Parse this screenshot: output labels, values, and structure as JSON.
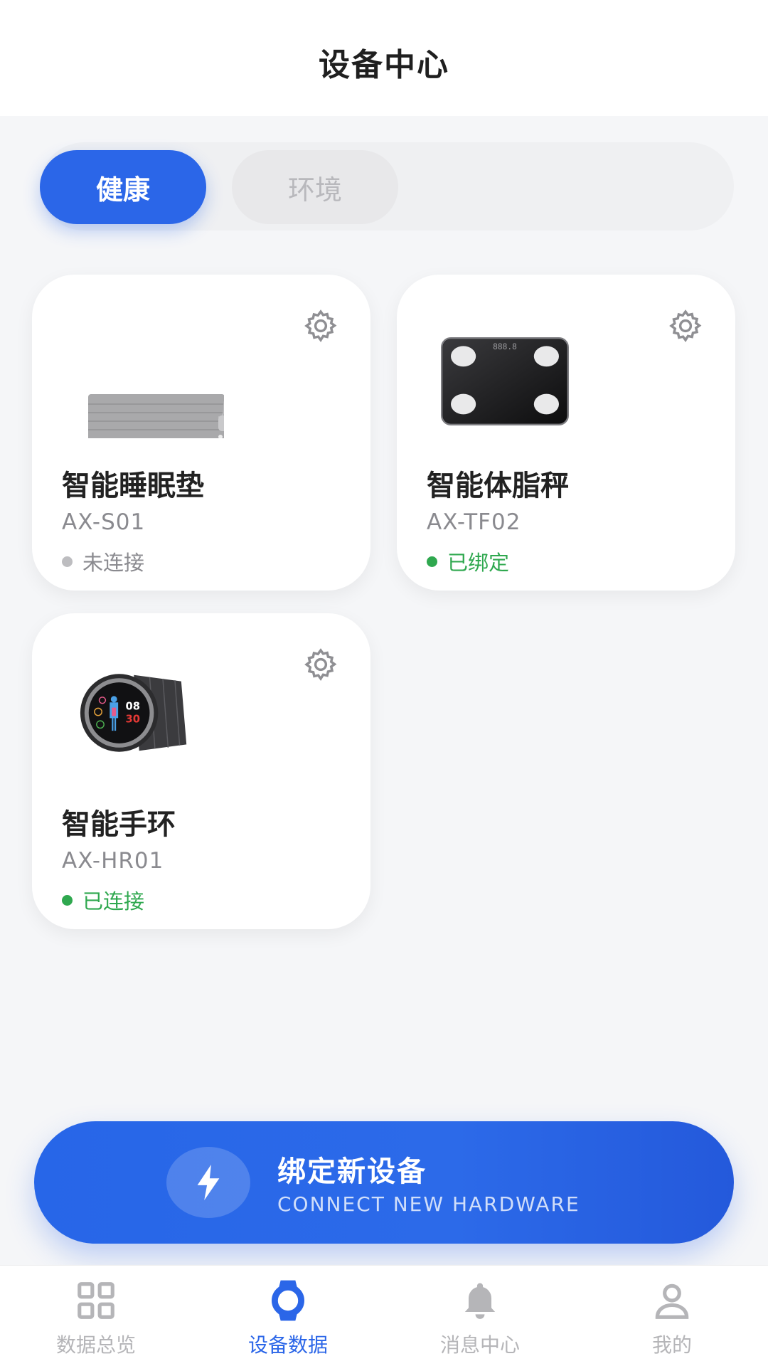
{
  "header": {
    "title": "设备中心"
  },
  "tabs": [
    {
      "label": "健康",
      "active": true
    },
    {
      "label": "环境",
      "active": false
    }
  ],
  "devices": [
    {
      "name": "智能睡眠垫",
      "model": "AX-S01",
      "status": "未连接",
      "state": "disconnected",
      "icon": "sleep-pad-image"
    },
    {
      "name": "智能体脂秤",
      "model": "AX-TF02",
      "status": "已绑定",
      "state": "bound",
      "icon": "body-fat-scale-image",
      "scale_display": "888.8"
    },
    {
      "name": "智能手环",
      "model": "AX-HR01",
      "status": "已连接",
      "state": "connected",
      "icon": "smart-watch-image",
      "watch_display": [
        "08",
        "30"
      ]
    }
  ],
  "bind": {
    "title": "绑定新设备",
    "subtitle": "CONNECT NEW HARDWARE"
  },
  "nav": [
    {
      "label": "数据总览",
      "icon": "grid-icon",
      "active": false
    },
    {
      "label": "设备数据",
      "icon": "watch-icon",
      "active": true
    },
    {
      "label": "消息中心",
      "icon": "bell-icon",
      "active": false
    },
    {
      "label": "我的",
      "icon": "user-icon",
      "active": false
    }
  ],
  "colors": {
    "primary": "#2b66e8",
    "status_connected": "#2fa84f",
    "status_disconnected": "#8a8a8f"
  }
}
